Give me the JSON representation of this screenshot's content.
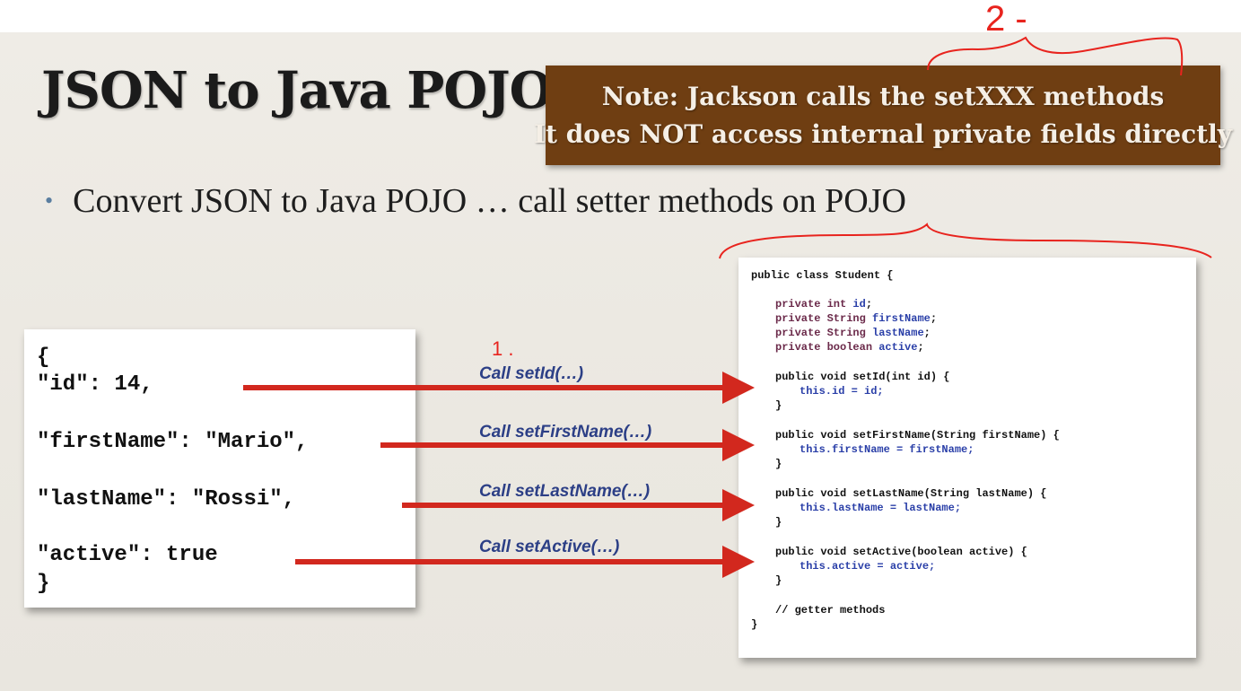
{
  "slide": {
    "title": "JSON to Java POJO",
    "note": {
      "line1": "Note: Jackson calls the setXXX methods",
      "line2": "It does NOT access internal private fields directly"
    },
    "bullet": "Convert JSON to Java POJO … call setter methods on POJO",
    "json_lines": [
      "{",
      "  \"id\": 14,",
      "  \"firstName\": \"Mario\",",
      "  \"lastName\": \"Rossi\",",
      "  \"active\": true",
      "}"
    ],
    "arrow_labels": [
      "Call setId(…)",
      "Call setFirstName(…)",
      "Call setLastName(…)",
      "Call setActive(…)"
    ],
    "code": {
      "class_decl": "public class Student {",
      "fields": [
        {
          "kw": "private int",
          "name": "id"
        },
        {
          "kw": "private String",
          "name": "firstName"
        },
        {
          "kw": "private String",
          "name": "lastName"
        },
        {
          "kw": "private boolean",
          "name": "active"
        }
      ],
      "setters": [
        {
          "sig": "public void setId(int id) {",
          "body": "this.id = id;"
        },
        {
          "sig": "public void setFirstName(String firstName) {",
          "body": "this.firstName = firstName;"
        },
        {
          "sig": "public void setLastName(String lastName) {",
          "body": "this.lastName = lastName;"
        },
        {
          "sig": "public void setActive(boolean active) {",
          "body": "this.active = active;"
        }
      ],
      "close_brace": "}",
      "comment": "// getter methods",
      "class_close": "}"
    },
    "annotations": {
      "mark_top": "2 -",
      "mark_mid": "1 ."
    },
    "colors": {
      "note_bg": "#6f3e12",
      "arrow": "#d2281e",
      "annotation": "#e8241e",
      "label": "#2c3f86"
    }
  }
}
